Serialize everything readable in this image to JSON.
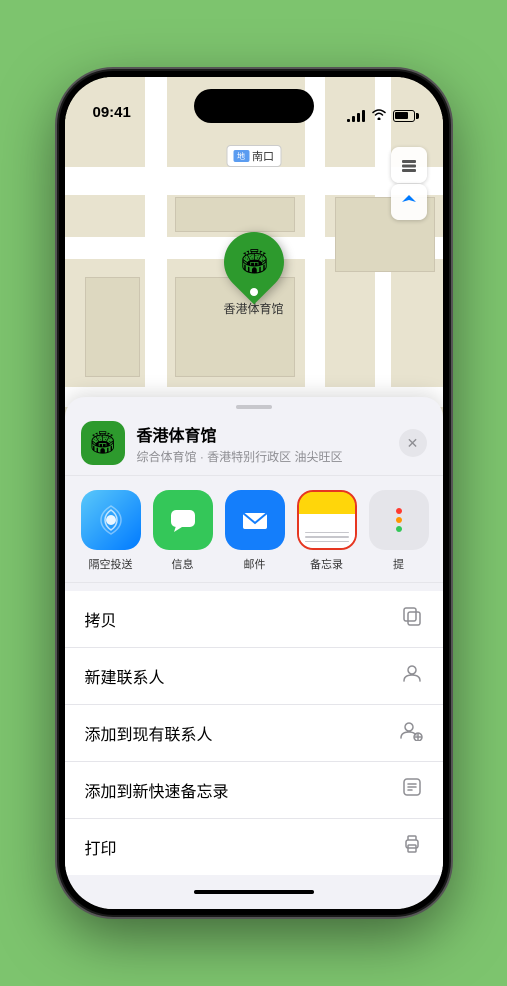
{
  "status": {
    "time": "09:41",
    "signal_bars": [
      3,
      6,
      9,
      12
    ],
    "wifi": "wifi",
    "battery_level": 75
  },
  "map": {
    "label": "南口",
    "map_icon": "地",
    "pin_label": "香港体育馆",
    "pin_emoji": "🏟"
  },
  "buttons": {
    "map_btn": "🗺",
    "location_btn": "⬆",
    "close": "✕"
  },
  "venue": {
    "icon": "🏟",
    "name": "香港体育馆",
    "description": "综合体育馆 · 香港特别行政区 油尖旺区"
  },
  "share_items": [
    {
      "id": "airdrop",
      "label": "隔空投送",
      "type": "airdrop"
    },
    {
      "id": "message",
      "label": "信息",
      "type": "message"
    },
    {
      "id": "mail",
      "label": "邮件",
      "type": "mail"
    },
    {
      "id": "notes",
      "label": "备忘录",
      "type": "notes",
      "selected": true
    },
    {
      "id": "more",
      "label": "提",
      "type": "more"
    }
  ],
  "actions": [
    {
      "id": "copy",
      "label": "拷贝",
      "icon": "⎘"
    },
    {
      "id": "new-contact",
      "label": "新建联系人",
      "icon": "👤"
    },
    {
      "id": "add-existing",
      "label": "添加到现有联系人",
      "icon": "👤+"
    },
    {
      "id": "add-note",
      "label": "添加到新快速备忘录",
      "icon": "📋"
    },
    {
      "id": "print",
      "label": "打印",
      "icon": "🖨"
    }
  ]
}
